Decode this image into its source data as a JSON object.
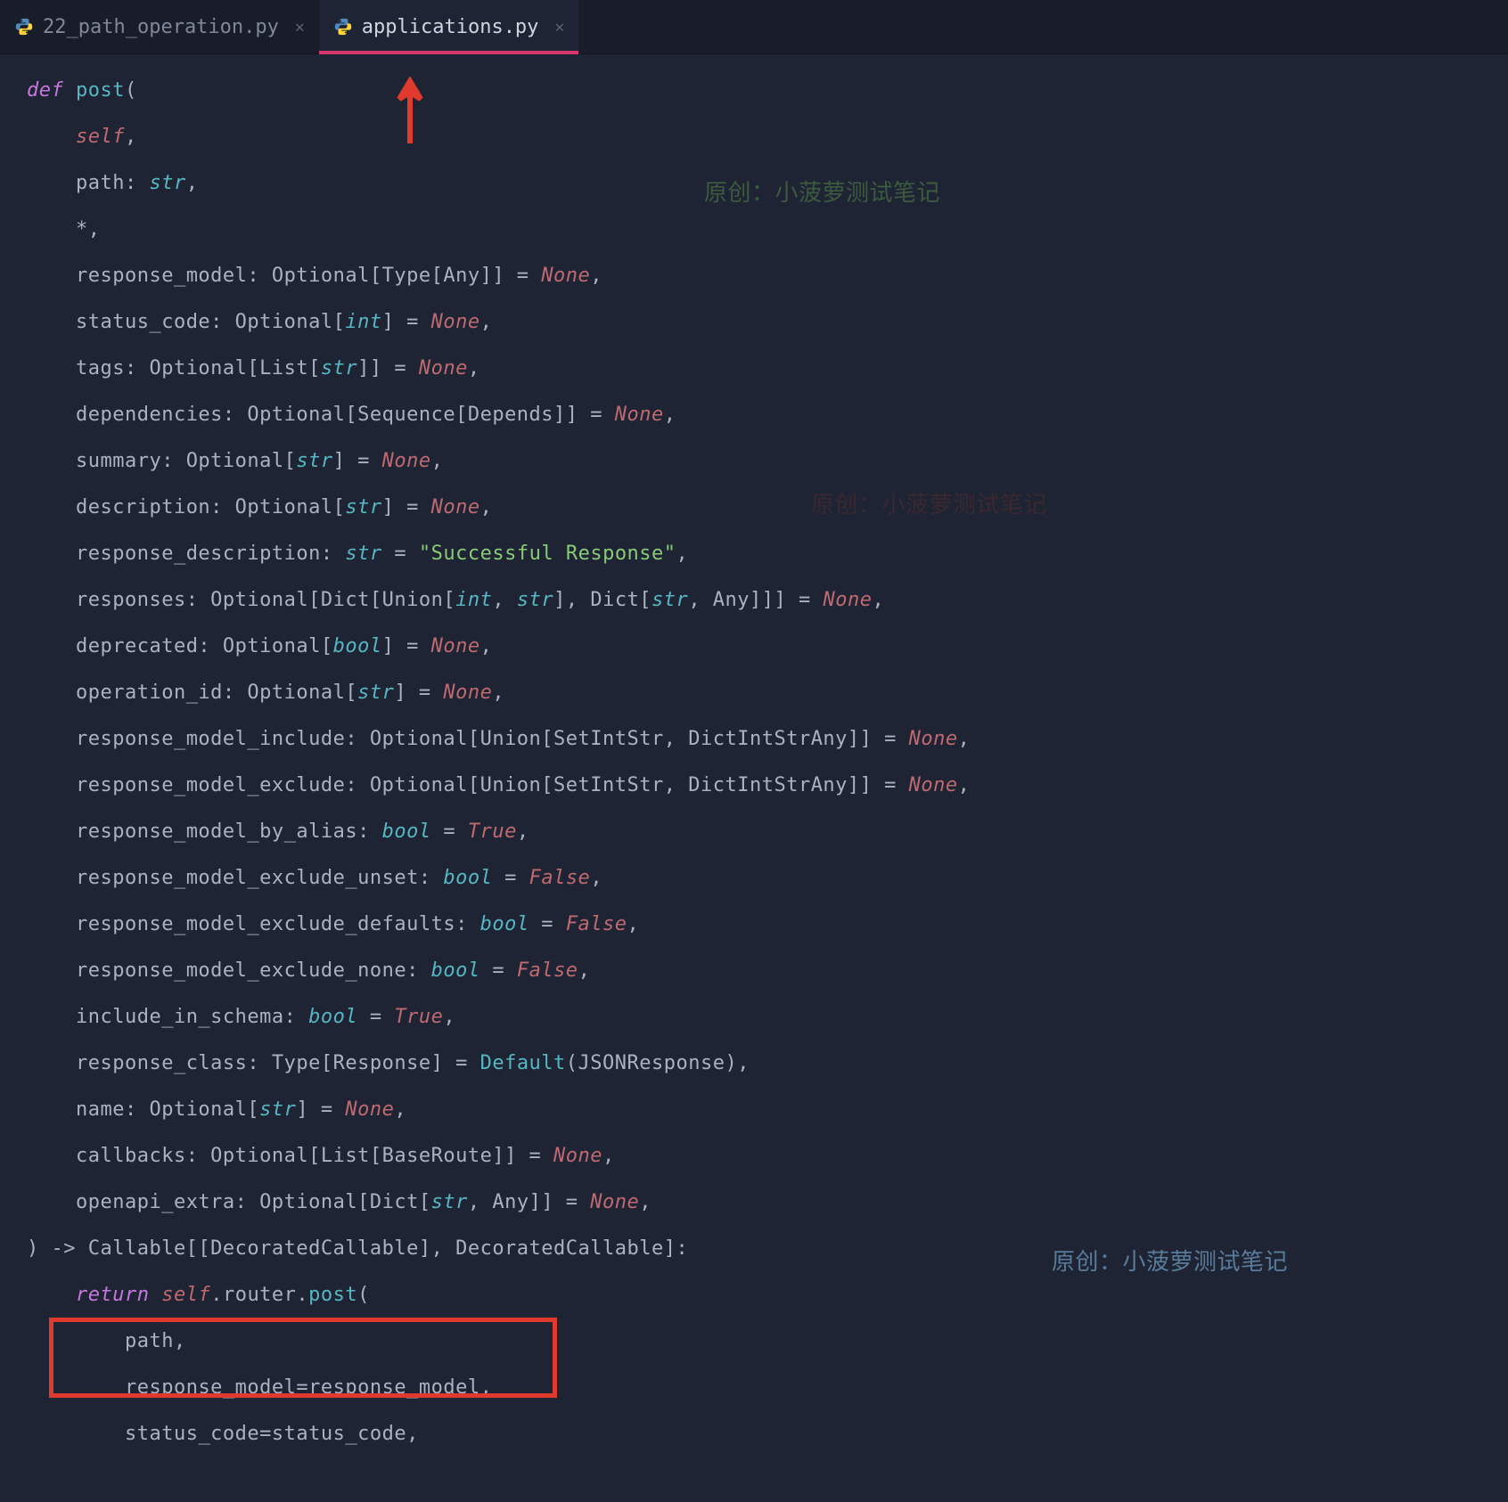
{
  "tabs": {
    "inactive": "22_path_operation.py",
    "active": "applications.py"
  },
  "watermarks": {
    "w1": "原创：小菠萝测试笔记",
    "w2": "原创：小菠萝测试笔记",
    "w3": "原创：小菠萝测试笔记"
  },
  "code": {
    "l01a": "def",
    "l01b": " post",
    "l01c": "(",
    "l02a": "self",
    "l02b": ",",
    "l03a": "path: ",
    "l03b": "str",
    "l03c": ",",
    "l04": "*,",
    "l05a": "response_model: Optional[Type[Any]] = ",
    "l05b": "None",
    "l05c": ",",
    "l06a": "status_code: Optional[",
    "l06b": "int",
    "l06c": "] = ",
    "l06d": "None",
    "l06e": ",",
    "l07a": "tags: Optional[List[",
    "l07b": "str",
    "l07c": "]] = ",
    "l07d": "None",
    "l07e": ",",
    "l08a": "dependencies: Optional[Sequence[Depends]] = ",
    "l08b": "None",
    "l08c": ",",
    "l09a": "summary: Optional[",
    "l09b": "str",
    "l09c": "] = ",
    "l09d": "None",
    "l09e": ",",
    "l10a": "description: Optional[",
    "l10b": "str",
    "l10c": "] = ",
    "l10d": "None",
    "l10e": ",",
    "l11a": "response_description: ",
    "l11b": "str",
    "l11c": " = ",
    "l11d": "\"Successful Response\"",
    "l11e": ",",
    "l12a": "responses: Optional[Dict[Union[",
    "l12b": "int",
    "l12c": ", ",
    "l12d": "str",
    "l12e": "], Dict[",
    "l12f": "str",
    "l12g": ", Any]]] = ",
    "l12h": "None",
    "l12i": ",",
    "l13a": "deprecated: Optional[",
    "l13b": "bool",
    "l13c": "] = ",
    "l13d": "None",
    "l13e": ",",
    "l14a": "operation_id: Optional[",
    "l14b": "str",
    "l14c": "] = ",
    "l14d": "None",
    "l14e": ",",
    "l15a": "response_model_include: Optional[Union[SetIntStr, DictIntStrAny]] = ",
    "l15b": "None",
    "l15c": ",",
    "l16a": "response_model_exclude: Optional[Union[SetIntStr, DictIntStrAny]] = ",
    "l16b": "None",
    "l16c": ",",
    "l17a": "response_model_by_alias: ",
    "l17b": "bool",
    "l17c": " = ",
    "l17d": "True",
    "l17e": ",",
    "l18a": "response_model_exclude_unset: ",
    "l18b": "bool",
    "l18c": " = ",
    "l18d": "False",
    "l18e": ",",
    "l19a": "response_model_exclude_defaults: ",
    "l19b": "bool",
    "l19c": " = ",
    "l19d": "False",
    "l19e": ",",
    "l20a": "response_model_exclude_none: ",
    "l20b": "bool",
    "l20c": " = ",
    "l20d": "False",
    "l20e": ",",
    "l21a": "include_in_schema: ",
    "l21b": "bool",
    "l21c": " = ",
    "l21d": "True",
    "l21e": ",",
    "l22a": "response_class: Type[Response] = ",
    "l22b": "Default",
    "l22c": "(JSONResponse),",
    "l23a": "name: Optional[",
    "l23b": "str",
    "l23c": "] = ",
    "l23d": "None",
    "l23e": ",",
    "l24a": "callbacks: Optional[List[BaseRoute]] = ",
    "l24b": "None",
    "l24c": ",",
    "l25a": "openapi_extra: Optional[Dict[",
    "l25b": "str",
    "l25c": ", Any]] = ",
    "l25d": "None",
    "l25e": ",",
    "l26": ") -> Callable[[DecoratedCallable], DecoratedCallable]:",
    "l27a": "return",
    "l27b": " self",
    "l27c": ".router.",
    "l27d": "post",
    "l27e": "(",
    "l28": "path,",
    "l29a": "response_model",
    "l29b": "=response_model,",
    "l30a": "status_code",
    "l30b": "=status_code,"
  }
}
